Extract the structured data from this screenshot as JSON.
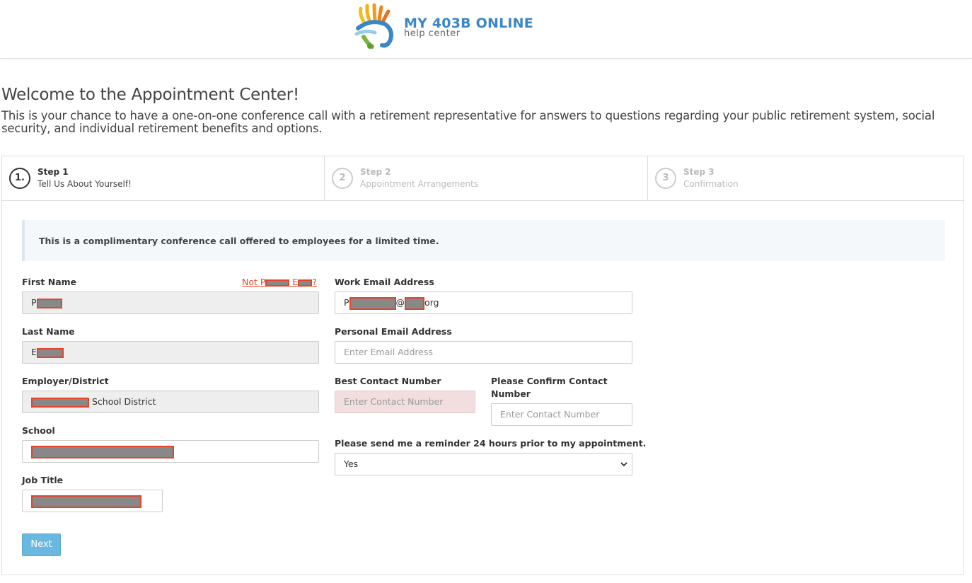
{
  "brand": {
    "title": "MY 403B ONLINE",
    "subtitle": "help center"
  },
  "intro": {
    "title": "Welcome to the Appointment Center!",
    "text": "This is your chance to have a one-on-one conference call with a retirement representative for answers to questions regarding your public retirement system, social security, and individual retirement benefits and options."
  },
  "steps": [
    {
      "number": "1.",
      "name": "Step 1",
      "desc": "Tell Us About Yourself!",
      "active": true
    },
    {
      "number": "2",
      "name": "Step 2",
      "desc": "Appointment Arrangements",
      "active": false
    },
    {
      "number": "3",
      "name": "Step 3",
      "desc": "Confirmation",
      "active": false
    }
  ],
  "notice": "This is a complimentary conference call offered to employees for a limited time.",
  "form": {
    "first_name": {
      "label": "First Name",
      "value_prefix": "P"
    },
    "not_link": {
      "prefix": "Not P",
      "suffix": "?"
    },
    "last_name": {
      "label": "Last Name",
      "value_prefix": "E"
    },
    "employer": {
      "label": "Employer/District",
      "value_suffix": "School District"
    },
    "school": {
      "label": "School"
    },
    "job_title": {
      "label": "Job Title"
    },
    "work_email": {
      "label": "Work Email Address",
      "value_prefix": "P",
      "at": "@",
      "value_suffix": "org"
    },
    "personal_email": {
      "label": "Personal Email Address",
      "placeholder": "Enter Email Address"
    },
    "contact": {
      "label": "Best Contact Number",
      "placeholder": "Enter Contact Number"
    },
    "confirm_contact": {
      "label": "Please Confirm Contact Number",
      "placeholder": "Enter Contact Number"
    },
    "reminder": {
      "label": "Please send me a reminder 24 hours prior to my appointment.",
      "selected": "Yes"
    },
    "next_label": "Next"
  }
}
